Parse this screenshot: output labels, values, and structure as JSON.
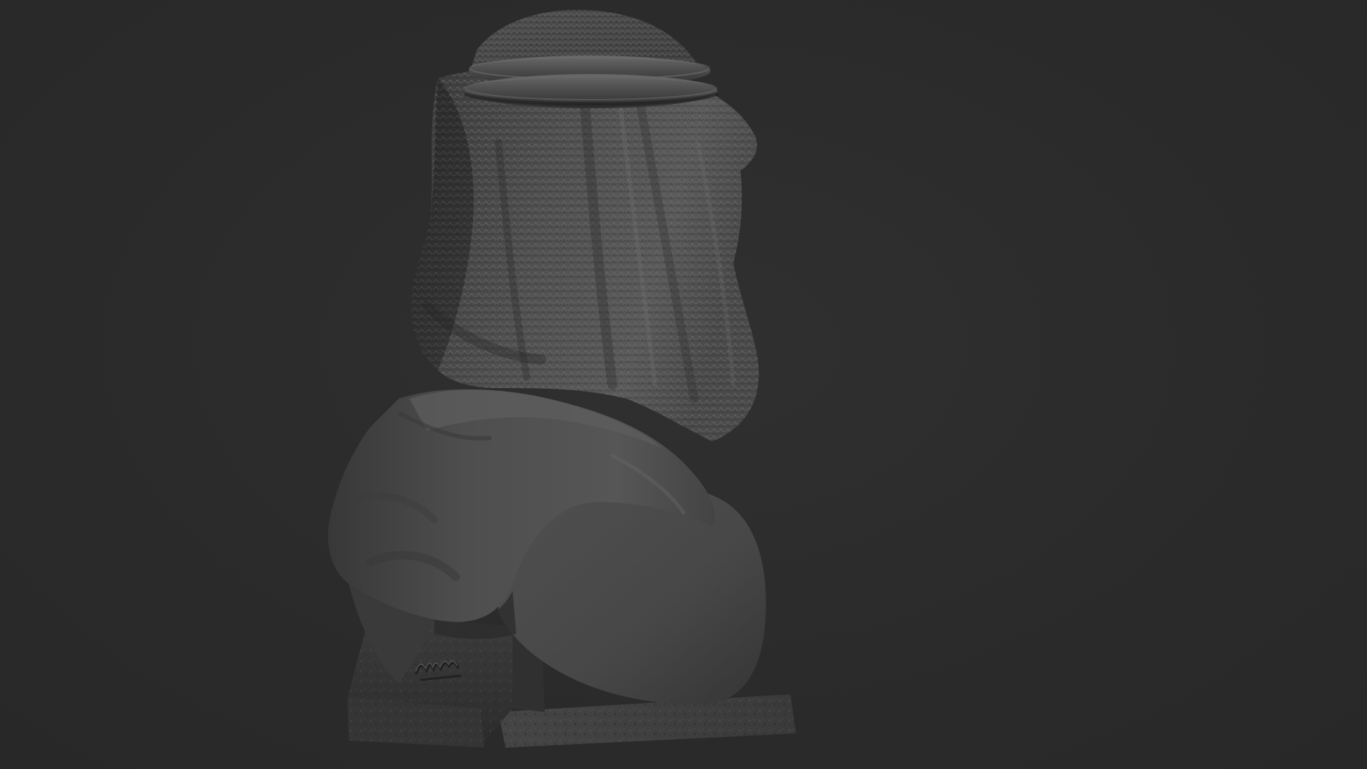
{
  "scene": {
    "subject": "bust-sculpt",
    "background_color": "#2b2b2b",
    "material_color": "#555555",
    "base_inscription": "signature-engraving"
  }
}
